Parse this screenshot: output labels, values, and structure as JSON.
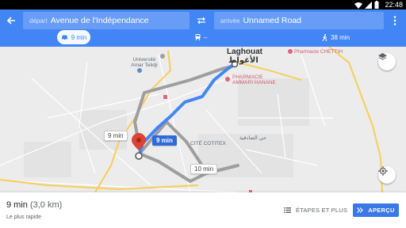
{
  "status_bar": {
    "time": "22:48"
  },
  "header": {
    "origin": {
      "label": "départ",
      "value": "Avenue de l'Indépendance"
    },
    "destination": {
      "label": "arrivée",
      "value": "Unnamed Road"
    },
    "modes": {
      "drive": {
        "time": "9 min",
        "icon": "car-icon"
      },
      "transit": {
        "time": "–",
        "icon": "train-icon"
      },
      "walk": {
        "time": "38 min",
        "icon": "walking-icon"
      }
    }
  },
  "map": {
    "labels": {
      "university": "Université\nAmar Telidji",
      "laghouat_fr": "Laghouat",
      "laghouat_ar": "الأغواط",
      "pharmacie_chettih": "Pharmacie CHETTIH",
      "pharmacie_ammari": "PHARMACIE\nAMMARI HANANE",
      "cite_cotitex": "CITÉ COTITEX",
      "hay_sadiqia": "حي الصادقية"
    },
    "route_times": {
      "main": "9 min",
      "alt_left": "9 min",
      "alt_bottom": "10 min"
    },
    "colors": {
      "route": "#4285f4",
      "alt_route": "#9e9e9e"
    }
  },
  "bottom": {
    "duration": "9 min",
    "distance": "(3,0 km)",
    "subtitle": "Le plus rapide",
    "steps_label": "ÉTAPES ET PLUS",
    "preview_label": "APERÇU"
  }
}
